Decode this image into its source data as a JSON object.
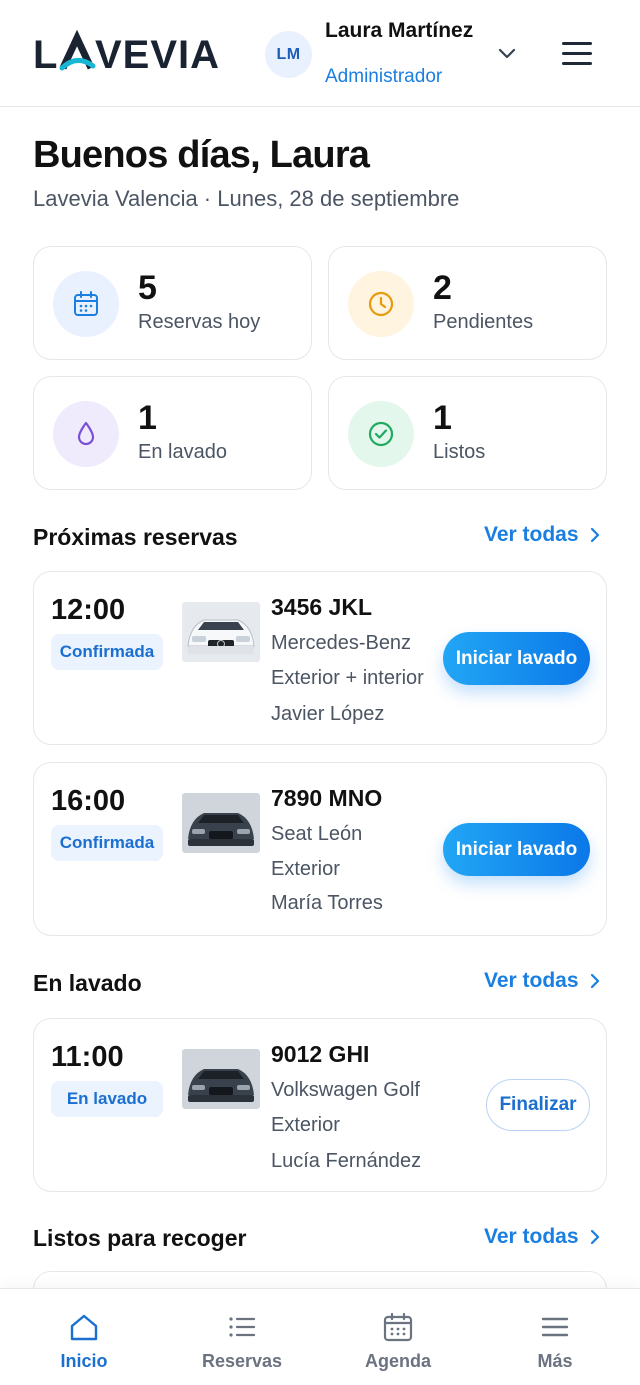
{
  "brand": {
    "logo_text": "LAVEVIA"
  },
  "user": {
    "initials": "LM",
    "name": "Laura Martínez",
    "role": "Administrador"
  },
  "greeting": {
    "title": "Buenos días, Laura",
    "subtitle": "Lavevia Valencia · Lunes, 28 de septiembre"
  },
  "stats": [
    {
      "value": "5",
      "label": "Reservas hoy",
      "icon": "calendar-icon",
      "color": "#1a7fe0",
      "bg": "#e8f1fd"
    },
    {
      "value": "2",
      "label": "Pendientes",
      "icon": "clock-icon",
      "color": "#e89a0c",
      "bg": "#fff4e0"
    },
    {
      "value": "1",
      "label": "En lavado",
      "icon": "water-drop-icon",
      "color": "#7b4fd6",
      "bg": "#f0ebfc"
    },
    {
      "value": "1",
      "label": "Listos",
      "icon": "check-circle-icon",
      "color": "#1faa5e",
      "bg": "#e3f7ec"
    }
  ],
  "sections": {
    "upcoming": {
      "title": "Próximas reservas",
      "link": "Ver todas",
      "items": [
        {
          "time": "12:00",
          "status": "Confirmada",
          "plate": "3456 JKL",
          "model": "Mercedes-Benz",
          "service": "Exterior + interior",
          "customer": "Javier López",
          "action": "Iniciar lavado",
          "car_color": "white"
        },
        {
          "time": "16:00",
          "status": "Confirmada",
          "plate": "7890 MNO",
          "model": "Seat León",
          "service": "Exterior",
          "customer": "María Torres",
          "action": "Iniciar lavado",
          "car_color": "dark"
        }
      ]
    },
    "washing": {
      "title": "En lavado",
      "link": "Ver todas",
      "items": [
        {
          "time": "11:00",
          "status": "En lavado",
          "plate": "9012 GHI",
          "model": "Volkswagen Golf",
          "service": "Exterior",
          "customer": "Lucía Fernández",
          "action": "Finalizar",
          "car_color": "dark"
        }
      ]
    },
    "ready": {
      "title": "Listos para recoger",
      "link": "Ver todas"
    }
  },
  "bottom_nav": [
    {
      "label": "Inicio",
      "icon": "home-icon",
      "active": true
    },
    {
      "label": "Reservas",
      "icon": "list-icon",
      "active": false
    },
    {
      "label": "Agenda",
      "icon": "calendar-icon",
      "active": false
    },
    {
      "label": "Más",
      "icon": "menu-icon",
      "active": false
    }
  ],
  "colors": {
    "accent": "#1a7fe0",
    "text": "#111827",
    "muted": "#4b5563",
    "border": "#e5e7eb"
  }
}
